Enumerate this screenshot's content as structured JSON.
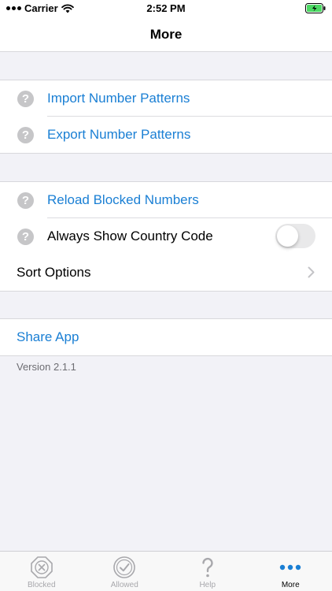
{
  "status_bar": {
    "carrier": "Carrier",
    "time": "2:52 PM"
  },
  "nav": {
    "title": "More"
  },
  "group1": {
    "items": [
      {
        "label": "Import Number Patterns",
        "icon": "help-icon"
      },
      {
        "label": "Export Number Patterns",
        "icon": "help-icon"
      }
    ]
  },
  "group2": {
    "items": [
      {
        "label": "Reload Blocked Numbers",
        "icon": "help-icon"
      },
      {
        "label": "Always Show Country Code",
        "icon": "help-icon",
        "toggle_on": false
      },
      {
        "label": "Sort Options",
        "icon": "chevron-right-icon"
      }
    ]
  },
  "group3": {
    "items": [
      {
        "label": "Share App"
      }
    ]
  },
  "version": "Version 2.1.1",
  "tabs": [
    {
      "label": "Blocked",
      "icon": "blocked-x-icon"
    },
    {
      "label": "Allowed",
      "icon": "allowed-check-icon"
    },
    {
      "label": "Help",
      "icon": "help-question-icon"
    },
    {
      "label": "More",
      "icon": "more-dots-icon",
      "active": true
    }
  ],
  "colors": {
    "accent": "#1a7fd4",
    "background": "#f2f2f7",
    "help_icon": "#c6c6c8",
    "battery_green": "#4cd964"
  }
}
